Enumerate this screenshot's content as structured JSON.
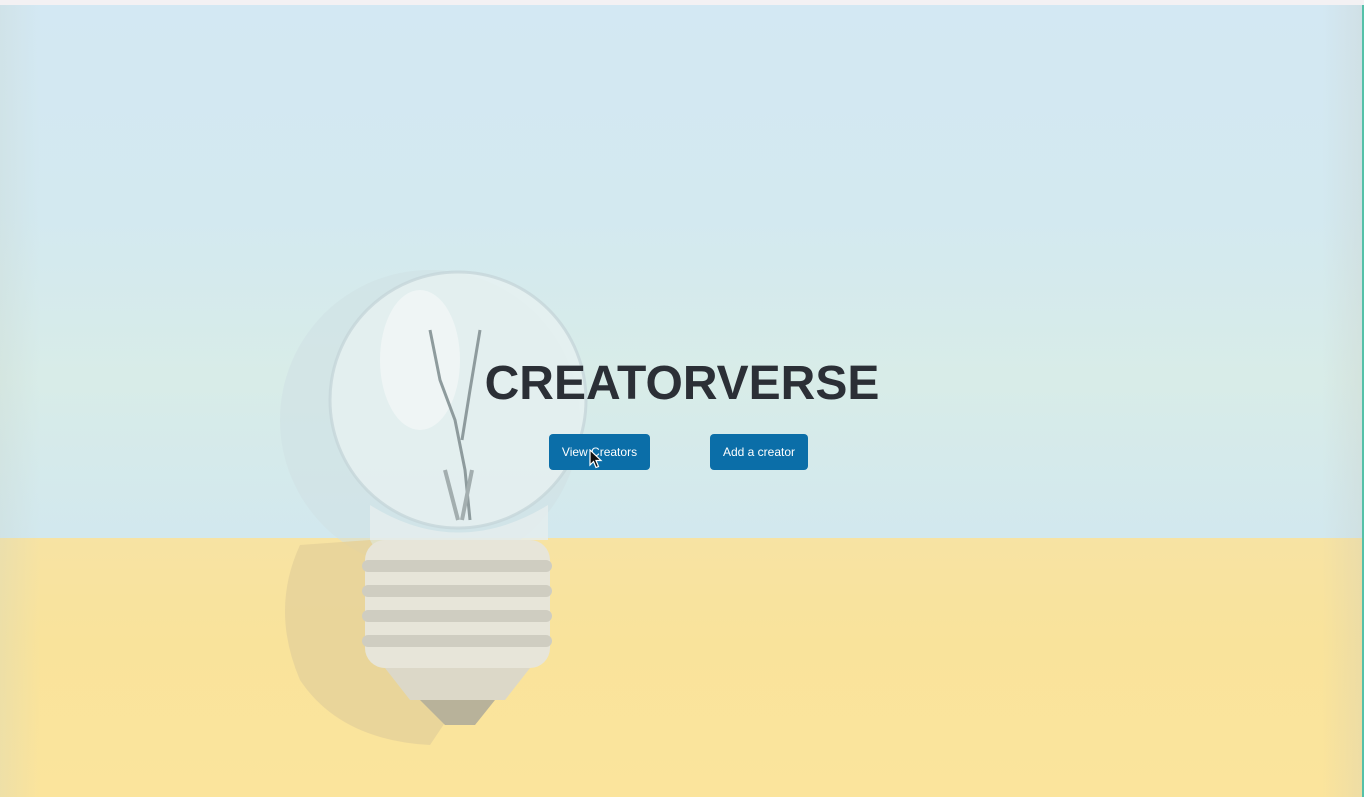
{
  "hero": {
    "title": "CREATORVERSE"
  },
  "actions": {
    "view_label": "View Creators",
    "add_label": "Add a creator"
  },
  "colors": {
    "button": "#0b6ea8",
    "title": "#2b2f36",
    "sky": "#d3e8f3",
    "table": "#fbe49c"
  },
  "icons": {
    "background": "light-bulb-photo",
    "pointer": "mouse-pointer-icon"
  }
}
